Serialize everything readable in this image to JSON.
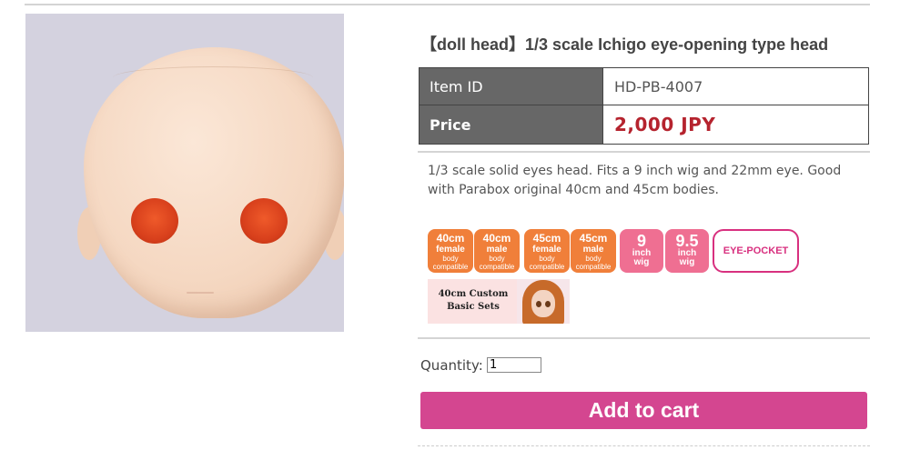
{
  "product": {
    "title": "【doll head】1/3 scale Ichigo eye-opening type head",
    "image_alt": "doll head photo"
  },
  "info_table": {
    "item_id_label": "Item ID",
    "item_id_value": "HD-PB-4007",
    "price_label": "Price",
    "price_value": "2,000 JPY"
  },
  "description": "1/3 scale solid eyes head. Fits a 9 inch wig and 22mm eye. Good with Parabox original 40cm and 45cm bodies.",
  "badges": [
    {
      "top": "40cm",
      "mid": "female",
      "bottom1": "body",
      "bottom2": "compatible"
    },
    {
      "top": "40cm",
      "mid": "male",
      "bottom1": "body",
      "bottom2": "compatible"
    },
    {
      "top": "45cm",
      "mid": "female",
      "bottom1": "body",
      "bottom2": "compatible"
    },
    {
      "top": "45cm",
      "mid": "male",
      "bottom1": "body",
      "bottom2": "compatible"
    }
  ],
  "wig_badges": [
    {
      "size": "9",
      "unit": "inch",
      "kind": "wig"
    },
    {
      "size": "9.5",
      "unit": "inch",
      "kind": "wig"
    }
  ],
  "eye_pocket_label": "EYE-POCKET",
  "basic_sets_banner": {
    "line1": "40cm Custom",
    "line2": "Basic Sets"
  },
  "purchase": {
    "quantity_label": "Quantity:",
    "quantity_value": "1",
    "add_to_cart_label": "Add to cart"
  },
  "colors": {
    "price_red": "#b5232e",
    "table_header_gray": "#676767",
    "badge_orange": "#f07f3a",
    "badge_pink": "#ef6f92",
    "eye_pocket_magenta": "#d8307f",
    "cart_button": "#d44690"
  }
}
